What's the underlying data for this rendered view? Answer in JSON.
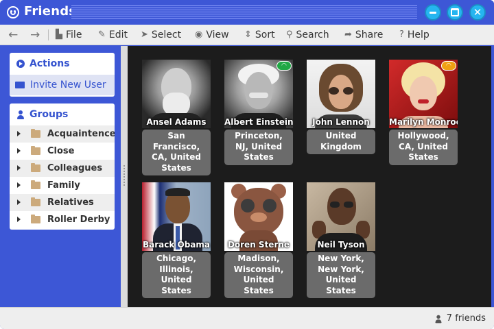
{
  "window": {
    "title": "Friends",
    "icon": "smiley-icon"
  },
  "menu": {
    "back_icon": "arrow-left-icon",
    "forward_icon": "arrow-right-icon",
    "items": [
      {
        "label": "File",
        "icon": "file-icon"
      },
      {
        "label": "Edit",
        "icon": "pencil-icon"
      },
      {
        "label": "Select",
        "icon": "cursor-icon"
      },
      {
        "label": "View",
        "icon": "eye-icon"
      },
      {
        "label": "Sort",
        "icon": "sort-icon"
      },
      {
        "label": "Search",
        "icon": "search-icon"
      },
      {
        "label": "Share",
        "icon": "share-icon"
      },
      {
        "label": "Help",
        "icon": "help-icon"
      }
    ]
  },
  "sidebar": {
    "actions": {
      "header": "Actions",
      "items": [
        {
          "label": "Invite New User",
          "icon": "mail-icon"
        }
      ]
    },
    "groups": {
      "header": "Groups",
      "items": [
        {
          "label": "Acquaintences"
        },
        {
          "label": "Close Friends"
        },
        {
          "label": "Colleagues"
        },
        {
          "label": "Family"
        },
        {
          "label": "Relatives"
        },
        {
          "label": "Roller Derby"
        }
      ]
    }
  },
  "friends": [
    {
      "name": "Ansel Adams",
      "location": "San Francisco, CA, United States",
      "status": null
    },
    {
      "name": "Albert Einstein",
      "location": "Princeton, NJ, United States",
      "status": "wifi-online"
    },
    {
      "name": "John Lennon",
      "location": "United Kingdom",
      "status": null
    },
    {
      "name": "Marilyn Monroe",
      "location": "Hollywood, CA, United States",
      "status": "wifi-away"
    },
    {
      "name": "Barack Obama",
      "location": "Chicago, Illinois, United States",
      "status": null
    },
    {
      "name": "Doren Sterne",
      "location": "Madison, Wisconsin, United States",
      "status": null
    },
    {
      "name": "Neil Tyson",
      "location": "New York, New York, United States",
      "status": null
    }
  ],
  "status_bar": {
    "count_text": "7 friends",
    "icon": "user-icon"
  },
  "colors": {
    "accent": "#3d57d6",
    "window_button": "#25b5f0",
    "status_online": "#21a845",
    "status_away": "#f0a012",
    "content_bg": "#1c1c1c"
  }
}
